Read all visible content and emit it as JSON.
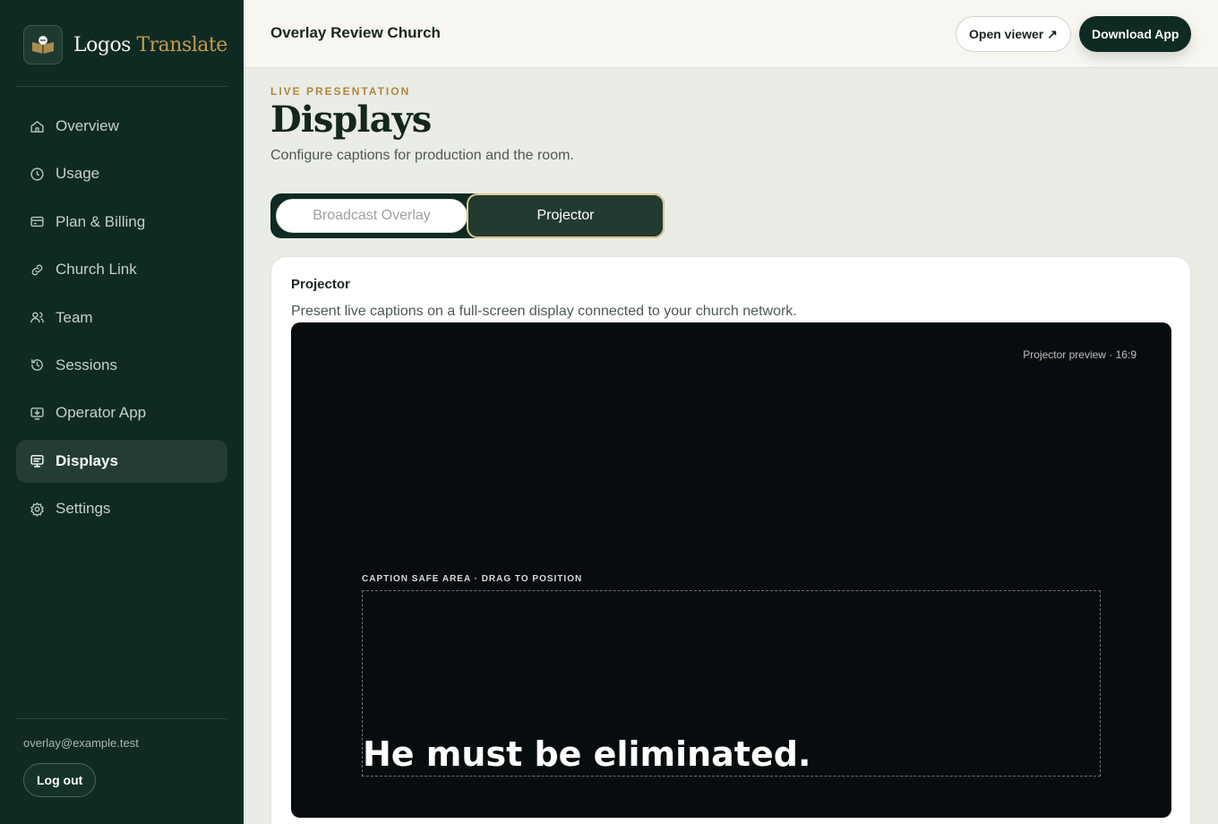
{
  "brand": {
    "name_primary": "Logos",
    "name_accent": "Translate"
  },
  "sidebar": {
    "items": [
      {
        "label": "Overview",
        "icon": "home-icon"
      },
      {
        "label": "Usage",
        "icon": "clock-icon"
      },
      {
        "label": "Plan & Billing",
        "icon": "credit-card-icon"
      },
      {
        "label": "Church Link",
        "icon": "link-icon"
      },
      {
        "label": "Team",
        "icon": "users-icon"
      },
      {
        "label": "Sessions",
        "icon": "history-icon"
      },
      {
        "label": "Operator App",
        "icon": "download-monitor-icon"
      },
      {
        "label": "Displays",
        "icon": "display-icon",
        "active": true
      },
      {
        "label": "Settings",
        "icon": "gear-icon"
      }
    ],
    "user_email": "overlay@example.test",
    "logout_label": "Log out"
  },
  "header": {
    "church_name": "Overlay Review Church",
    "open_viewer_label": "Open viewer ↗",
    "download_label": "Download App"
  },
  "page": {
    "eyebrow": "LIVE PRESENTATION",
    "title": "Displays",
    "subtitle": "Configure captions for production and the room."
  },
  "tabs": [
    {
      "label": "Broadcast Overlay",
      "active": false
    },
    {
      "label": "Projector",
      "active": true
    }
  ],
  "card": {
    "title": "Projector",
    "description": "Present live captions on a full-screen display connected to your church network.",
    "preview_label": "Projector preview · 16:9",
    "safe_area_label": "CAPTION SAFE AREA · DRAG TO POSITION",
    "caption_text": "He must be eliminated."
  },
  "colors": {
    "sidebar_bg": "#0f2a22",
    "accent_gold": "#c49a52",
    "active_tab_border": "#e2c58a",
    "preview_bg": "#070c0e"
  }
}
